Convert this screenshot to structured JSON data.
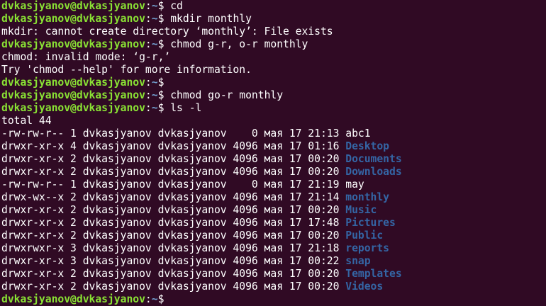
{
  "prompt": {
    "user_host": "dvkasjyanov@dvkasjyanov",
    "colon": ":",
    "path": "~",
    "dollar": "$ "
  },
  "session": [
    {
      "kind": "prompt",
      "cmd": "cd"
    },
    {
      "kind": "prompt",
      "cmd": "mkdir monthly"
    },
    {
      "kind": "output",
      "text": "mkdir: cannot create directory ‘monthly’: File exists"
    },
    {
      "kind": "prompt",
      "cmd": "chmod g-r, o-r monthly"
    },
    {
      "kind": "output",
      "text": "chmod: invalid mode: ‘g-r,’"
    },
    {
      "kind": "output",
      "text": "Try 'chmod --help' for more information."
    },
    {
      "kind": "prompt",
      "cmd": ""
    },
    {
      "kind": "prompt",
      "cmd": "chmod go-r monthly"
    },
    {
      "kind": "prompt",
      "cmd": "ls -l"
    },
    {
      "kind": "output",
      "text": "total 44"
    },
    {
      "kind": "entry",
      "prefix": "-rw-rw-r-- 1 dvkasjyanov dvkasjyanov    0 мая 17 21:13 ",
      "name": "abc1",
      "is_dir": false
    },
    {
      "kind": "entry",
      "prefix": "drwxr-xr-x 4 dvkasjyanov dvkasjyanov 4096 мая 17 01:16 ",
      "name": "Desktop",
      "is_dir": true
    },
    {
      "kind": "entry",
      "prefix": "drwxr-xr-x 2 dvkasjyanov dvkasjyanov 4096 мая 17 00:20 ",
      "name": "Documents",
      "is_dir": true
    },
    {
      "kind": "entry",
      "prefix": "drwxr-xr-x 2 dvkasjyanov dvkasjyanov 4096 мая 17 00:20 ",
      "name": "Downloads",
      "is_dir": true
    },
    {
      "kind": "entry",
      "prefix": "-rw-rw-r-- 1 dvkasjyanov dvkasjyanov    0 мая 17 21:19 ",
      "name": "may",
      "is_dir": false
    },
    {
      "kind": "entry",
      "prefix": "drwx-wx--x 2 dvkasjyanov dvkasjyanov 4096 мая 17 21:14 ",
      "name": "monthly",
      "is_dir": true
    },
    {
      "kind": "entry",
      "prefix": "drwxr-xr-x 2 dvkasjyanov dvkasjyanov 4096 мая 17 00:20 ",
      "name": "Music",
      "is_dir": true
    },
    {
      "kind": "entry",
      "prefix": "drwxr-xr-x 2 dvkasjyanov dvkasjyanov 4096 мая 17 17:48 ",
      "name": "Pictures",
      "is_dir": true
    },
    {
      "kind": "entry",
      "prefix": "drwxr-xr-x 2 dvkasjyanov dvkasjyanov 4096 мая 17 00:20 ",
      "name": "Public",
      "is_dir": true
    },
    {
      "kind": "entry",
      "prefix": "drwxrwxr-x 3 dvkasjyanov dvkasjyanov 4096 мая 17 21:18 ",
      "name": "reports",
      "is_dir": true
    },
    {
      "kind": "entry",
      "prefix": "drwxr-xr-x 3 dvkasjyanov dvkasjyanov 4096 мая 17 00:22 ",
      "name": "snap",
      "is_dir": true
    },
    {
      "kind": "entry",
      "prefix": "drwxr-xr-x 2 dvkasjyanov dvkasjyanov 4096 мая 17 00:20 ",
      "name": "Templates",
      "is_dir": true
    },
    {
      "kind": "entry",
      "prefix": "drwxr-xr-x 2 dvkasjyanov dvkasjyanov 4096 мая 17 00:20 ",
      "name": "Videos",
      "is_dir": true
    },
    {
      "kind": "prompt",
      "cmd": ""
    }
  ],
  "colors": {
    "background": "#300a24",
    "prompt_user": "#8ae234",
    "prompt_path": "#729fcf",
    "directory": "#3465a4",
    "text": "#ffffff"
  }
}
